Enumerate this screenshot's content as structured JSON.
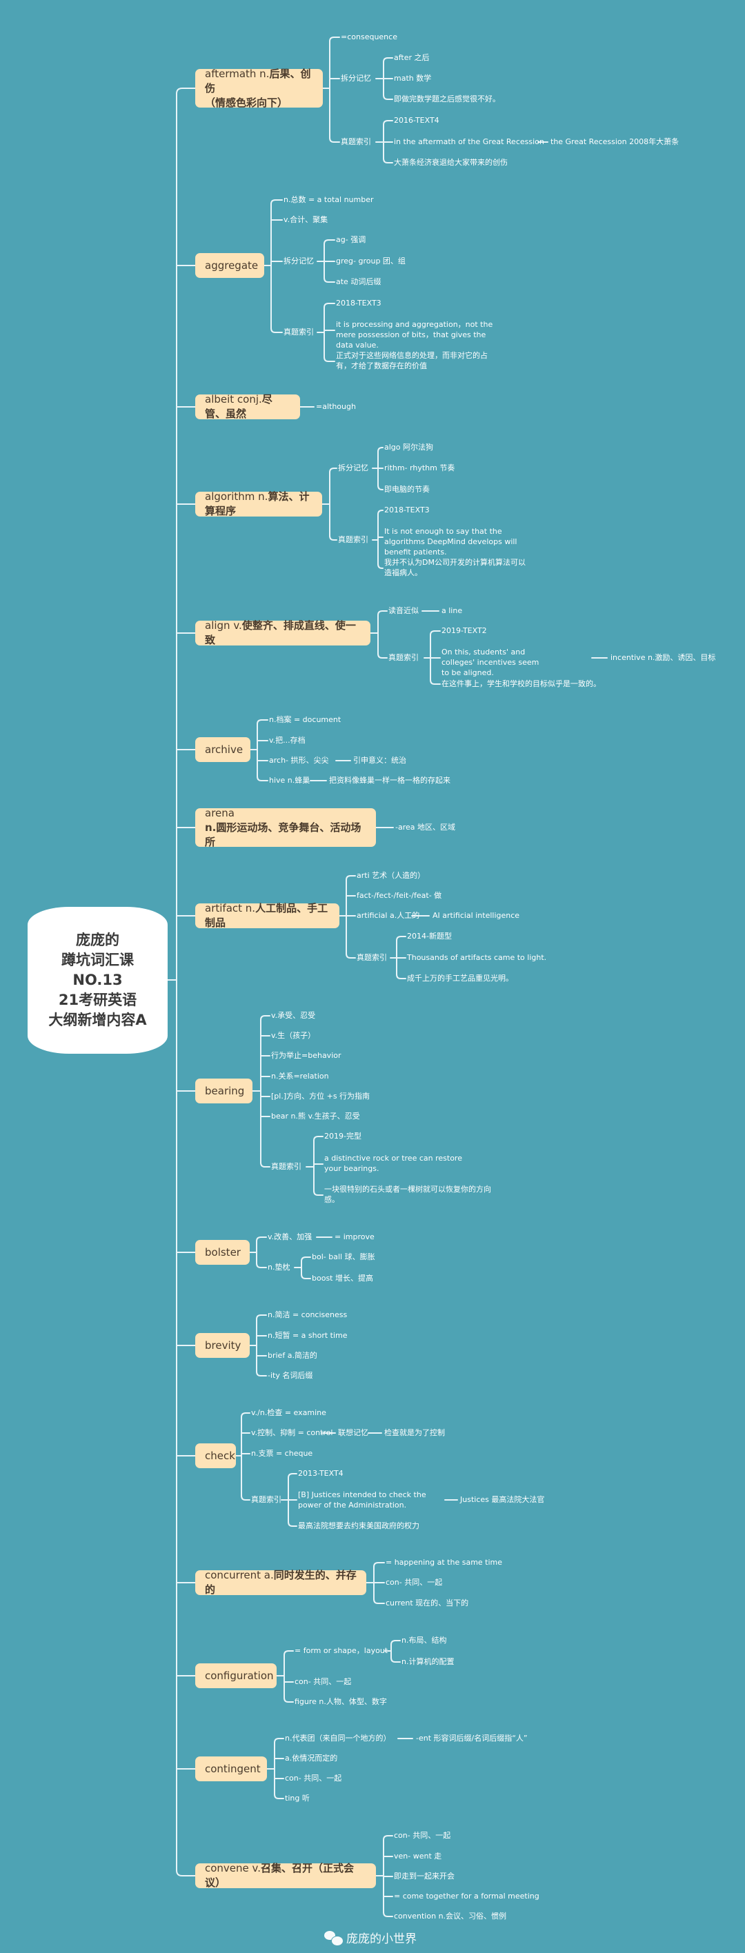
{
  "root": {
    "lines": [
      "庞庞的",
      "蹲坑词汇课",
      "NO.13",
      "21考研英语",
      "大纲新增内容A"
    ]
  },
  "topics": [
    {
      "id": "aftermath",
      "word": "aftermath n.",
      "meaning": "后果、创伤",
      "meaning2": "（情感色彩向下）"
    },
    {
      "id": "aggregate",
      "word": "aggregate",
      "meaning": ""
    },
    {
      "id": "albeit",
      "word": "albeit conj.",
      "meaning": "尽管、虽然"
    },
    {
      "id": "algorithm",
      "word": "algorithm n.",
      "meaning": "算法、计算程序"
    },
    {
      "id": "align",
      "word": "align v.",
      "meaning": "使整齐、排成直线、使一致"
    },
    {
      "id": "archive",
      "word": "archive",
      "meaning": ""
    },
    {
      "id": "arena",
      "word": "arena",
      "meaning": "n.圆形运动场、竞争舞台、活动场所"
    },
    {
      "id": "artifact",
      "word": "artifact n.",
      "meaning": "人工制品、手工制品"
    },
    {
      "id": "bearing",
      "word": "bearing",
      "meaning": ""
    },
    {
      "id": "bolster",
      "word": "bolster",
      "meaning": ""
    },
    {
      "id": "brevity",
      "word": "brevity",
      "meaning": ""
    },
    {
      "id": "check",
      "word": "check",
      "meaning": ""
    },
    {
      "id": "concurrent",
      "word": "concurrent a.",
      "meaning": "同时发生的、并存的"
    },
    {
      "id": "configuration",
      "word": "configuration",
      "meaning": ""
    },
    {
      "id": "contingent",
      "word": "contingent",
      "meaning": ""
    },
    {
      "id": "convene",
      "word": "convene v.",
      "meaning": "召集、召开（正式会议）"
    }
  ],
  "labels": {
    "af1": "=consequence",
    "af2": "拆分记忆",
    "af3": "after 之后",
    "af4": "math 数学",
    "af5": "即做完数学题之后感觉很不好。",
    "af6": "真题索引",
    "af7": "2016-TEXT4",
    "af8": "in the aftermath of the Great Recession",
    "af9": "the Great Recession 2008年大萧条",
    "af10": "大萧条经济衰退给大家带来的创伤",
    "ag1": "n.总数 = a total number",
    "ag2": "v.合计、聚集",
    "ag3": "拆分记忆",
    "ag4": "ag- 强调",
    "ag5": "greg- group 团、组",
    "ag6": "ate 动词后缀",
    "ag7": "真题索引",
    "ag8": "2018-TEXT3",
    "ag9": "it is processing and aggregation，not the mere possession of bits，that gives the data value.",
    "ag10": "正式对于这些网络信息的处理，而非对它的占有，才给了数据存在的价值",
    "al1": "=although",
    "alg1": "拆分记忆",
    "alg2": "algo 阿尔法狗",
    "alg3": "rithm- rhythm 节奏",
    "alg4": "即电脑的节奏",
    "alg5": "真题索引",
    "alg6": "2018-TEXT3",
    "alg7": "It is not enough to say that the algorithms DeepMind develops will benefit patients.",
    "alg8": "我并不认为DM公司开发的计算机算法可以造福病人。",
    "ali1": "读音近似",
    "ali2": "a line",
    "ali3": "真题索引",
    "ali4": "2019-TEXT2",
    "ali5": "On this, students' and colleges' incentives seem to be aligned.",
    "ali6": "incentive n.激励、诱因、目标",
    "ali7": "在这件事上，学生和学校的目标似乎是一致的。",
    "ar1": "n.档案 = document",
    "ar2": "v.把...存档",
    "ar3": "arch- 拱形、尖尖",
    "ar4": "引申意义：统治",
    "ar5": "hive n.蜂巢",
    "ar6": "把资料像蜂巢一样一格一格的存起来",
    "are1": "-area 地区、区域",
    "art1": "arti 艺术（人造的）",
    "art2": "fact-/fect-/feit-/feat- 做",
    "art3": "artificial a.人工的",
    "art4": "AI artificial intelligence",
    "art5": "真题索引",
    "art6": "2014-新题型",
    "art7": "Thousands of artifacts came to light.",
    "art8": "成千上万的手工艺品重见光明。",
    "be1": "v.承受、忍受",
    "be2": "v.生（孩子）",
    "be3": "行为举止=behavior",
    "be4": "n.关系=relation",
    "be5": "[pl.]方向、方位 +s 行为指南",
    "be6": "bear n.熊 v.生孩子、忍受",
    "be7": "真题索引",
    "be8": "2019-完型",
    "be9": "a distinctive rock or tree can restore your bearings.",
    "be10": "一块很特别的石头或者一棵树就可以恢复你的方向感。",
    "bo1": "v.改善、加强",
    "bo2": "= improve",
    "bo3": "n.垫枕",
    "bo4": "bol- ball 球、膨胀",
    "bo5": "boost 增长、提高",
    "br1": "n.简洁 = conciseness",
    "br2": "n.短暂 = a short time",
    "br3": "brief a.简洁的",
    "br4": "-ity 名词后缀",
    "ch1": "v./n.检查 = examine",
    "ch2": "v.控制、抑制 = control",
    "ch3": "联想记忆",
    "ch4": "检查就是为了控制",
    "ch5": "n.支票 = cheque",
    "ch6": "真题索引",
    "ch7": "2013-TEXT4",
    "ch8": "[B] Justices intended to check the power of the Administration.",
    "ch9": "Justices 最高法院大法官",
    "ch10": "最高法院想要去约束美国政府的权力",
    "cc1": "= happening at the same time",
    "cc2": "con- 共同、一起",
    "cc3": "current 现在的、当下的",
    "cf1": "= form or shape，layout",
    "cf2": "n.布局、结构",
    "cf3": "n.计算机的配置",
    "cf4": "con- 共同、一起",
    "cf5": "figure n.人物、体型、数字",
    "ct1": "n.代表团（来自同一个地方的）",
    "ct2": "-ent 形容词后缀/名词后缀指“人”",
    "ct3": "a.依情况而定的",
    "ct4": "con- 共同、一起",
    "ct5": "ting 听",
    "cv1": "con- 共同、一起",
    "cv2": "ven- went 走",
    "cv3": "即走到一起来开会",
    "cv4": "= come together for a formal meeting",
    "cv5": "convention n.会议、习俗、惯例"
  },
  "footer": {
    "icon": "wechat-icon",
    "text": "庞庞的小世界"
  },
  "colors": {
    "background": "#4ea3b4",
    "topic_fill": "#fde3b8",
    "root_fill": "#ffffff",
    "line": "#e8f4f8"
  }
}
